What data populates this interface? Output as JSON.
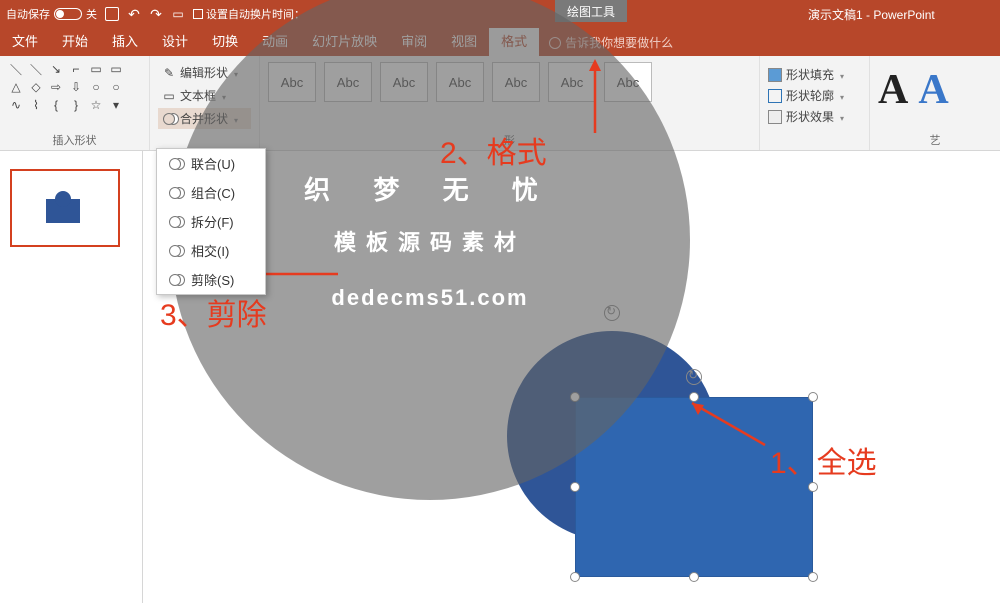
{
  "titlebar": {
    "autosave": "自动保存",
    "autosave_off": "关",
    "timing_label": "设置自动换片时间：",
    "context_tools": "绘图工具",
    "doc_title": "演示文稿1 - PowerPoint"
  },
  "tabs": {
    "file": "文件",
    "home": "开始",
    "insert": "插入",
    "design": "设计",
    "transitions": "切换",
    "animations": "动画",
    "slideshow": "幻灯片放映",
    "review": "审阅",
    "view": "视图",
    "format": "格式",
    "tellme": "告诉我你想要做什么"
  },
  "ribbon": {
    "insert_shapes_label": "插入形状",
    "edit_shape": "编辑形状",
    "text_box": "文本框",
    "merge_shapes": "合并形状",
    "style_abc": "Abc",
    "styles_label": "形",
    "fill": "形状填充",
    "outline": "形状轮廓",
    "effects": "形状效果",
    "wordart_label": "艺"
  },
  "merge_menu": {
    "union": "联合(U)",
    "combine": "组合(C)",
    "fragment": "拆分(F)",
    "intersect": "相交(I)",
    "subtract": "剪除(S)"
  },
  "annotations": {
    "a1": "1、全选",
    "a2": "2、格式",
    "a3": "3、剪除"
  },
  "watermark": {
    "top": "织 梦 无 忧",
    "mid": "模板源码素材",
    "url": "dedecms51.com"
  }
}
